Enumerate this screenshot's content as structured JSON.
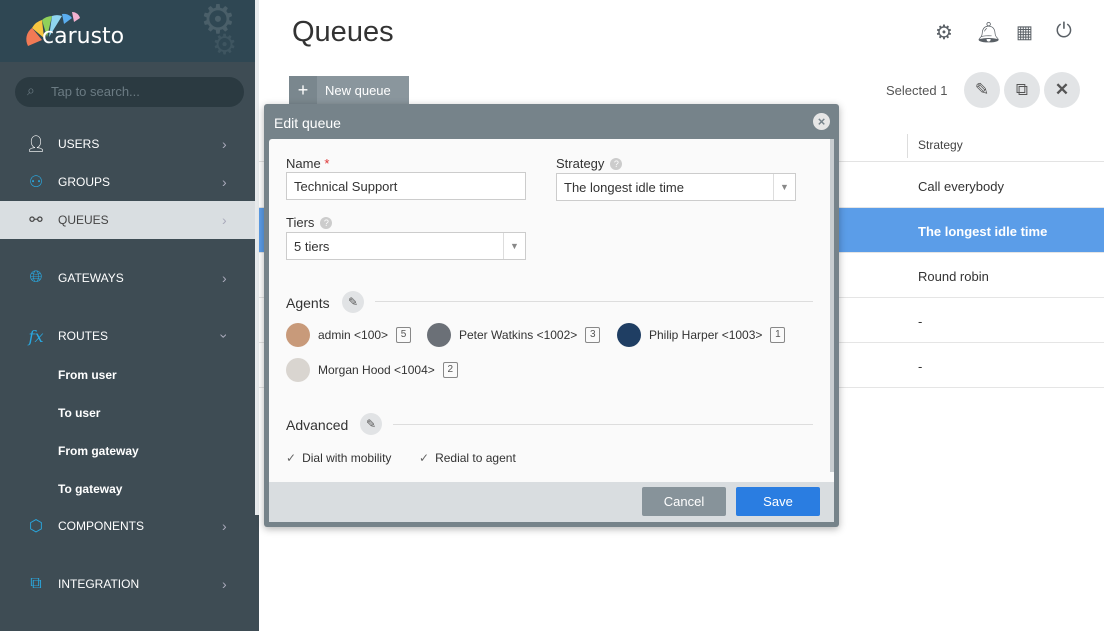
{
  "app": {
    "logo": "carusto",
    "search_placeholder": "Tap to search..."
  },
  "sidebar": {
    "items": [
      {
        "label": "USERS",
        "icon": "user-icon"
      },
      {
        "label": "GROUPS",
        "icon": "groups-icon"
      },
      {
        "label": "QUEUES",
        "icon": "queues-icon",
        "active": true
      },
      {
        "label": "GATEWAYS",
        "icon": "globe-icon"
      },
      {
        "label": "ROUTES",
        "icon": "fx-icon",
        "expanded": true
      },
      {
        "label": "COMPONENTS",
        "icon": "cube-icon"
      },
      {
        "label": "INTEGRATION",
        "icon": "integration-icon"
      }
    ],
    "routes_sub": [
      "From user",
      "To user",
      "From gateway",
      "To gateway"
    ]
  },
  "header": {
    "title": "Queues",
    "icons": [
      "settings-icon",
      "bell-icon",
      "apps-grid-icon",
      "power-icon"
    ]
  },
  "toolbar": {
    "new_queue": "New queue",
    "selected": "Selected 1"
  },
  "table": {
    "strategy_header": "Strategy",
    "rows": [
      "Call everybody",
      "The longest idle time",
      "Round robin",
      "-",
      "-"
    ],
    "selected_index": 1
  },
  "colors": {
    "accent": "#5b9de8",
    "sidebar": "#3e4c54",
    "save": "#2a7de1"
  },
  "modal": {
    "title": "Edit queue",
    "name_label": "Name",
    "required_mark": "*",
    "name_value": "Technical Support",
    "strategy_label": "Strategy",
    "strategy_value": "The longest idle time",
    "tiers_label": "Tiers",
    "tiers_value": "5 tiers",
    "agents_label": "Agents",
    "agents": [
      {
        "name": "admin <100>",
        "tier": "5"
      },
      {
        "name": "Peter Watkins <1002>",
        "tier": "3"
      },
      {
        "name": "Philip Harper <1003>",
        "tier": "1"
      },
      {
        "name": "Morgan Hood <1004>",
        "tier": "2"
      }
    ],
    "advanced_label": "Advanced",
    "options": [
      "Dial with mobility",
      "Redial to agent"
    ],
    "cancel": "Cancel",
    "save": "Save"
  }
}
